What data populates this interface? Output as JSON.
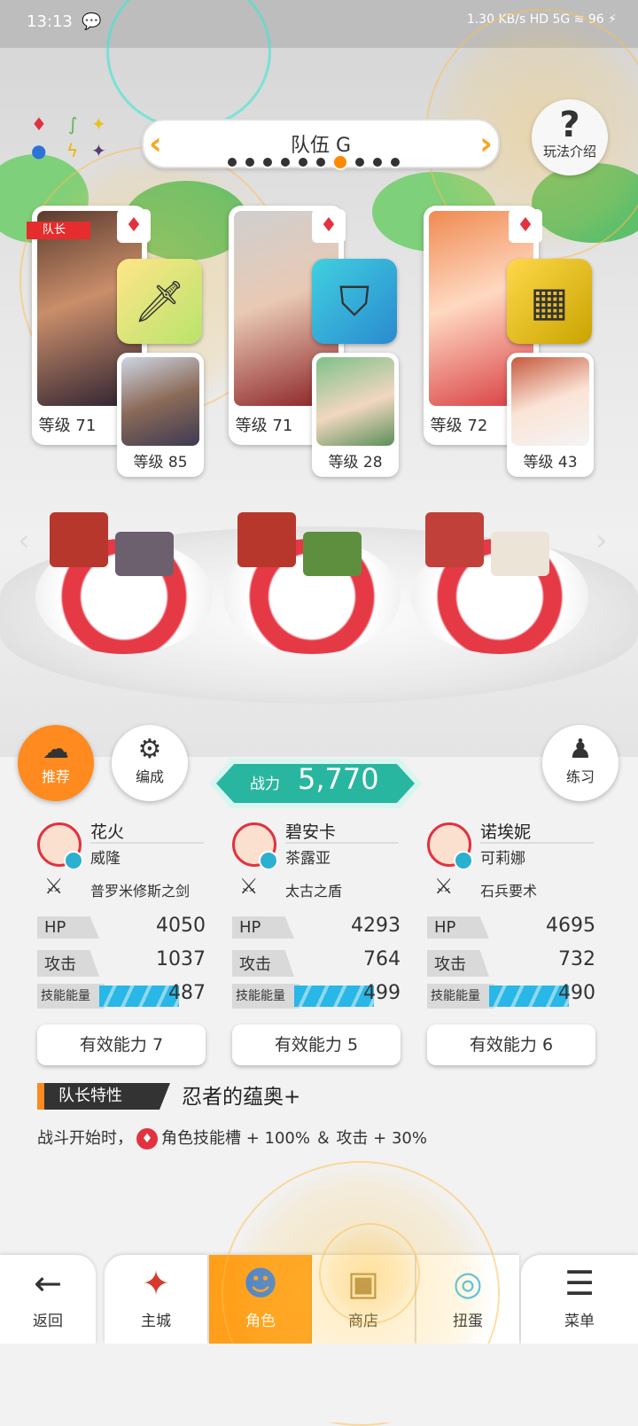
{
  "status_bar": {
    "time": "13:13",
    "network_speed": "1.30 KB/s",
    "hd": "HD",
    "signal": "5G",
    "battery": "96"
  },
  "team": {
    "title": "队伍 G",
    "page_count": 10,
    "active_index": 7,
    "prev_icon": "chevron-left-icon",
    "next_icon": "chevron-right-icon"
  },
  "help": {
    "label": "玩法介绍"
  },
  "leader_tag": "队长",
  "characters": [
    {
      "level": "等级 71",
      "partner_level": "等级 85",
      "equip_icon": "sword-icon"
    },
    {
      "level": "等级 71",
      "partner_level": "等级 28",
      "equip_icon": "shield-icon"
    },
    {
      "level": "等级 72",
      "partner_level": "等级 43",
      "equip_icon": "stone-tablet-icon"
    }
  ],
  "actions": {
    "recommend": "推荐",
    "formation": "编成",
    "practice": "练习"
  },
  "power": {
    "label": "战力",
    "value": "5,770"
  },
  "columns": [
    {
      "name": "花火",
      "partner": "威隆",
      "weapon": "普罗米修斯之剑",
      "hp_label": "HP",
      "hp": "4050",
      "atk_label": "攻击",
      "atk": "1037",
      "energy_label": "技能能量",
      "energy": "487",
      "ability": "有效能力 7"
    },
    {
      "name": "碧安卡",
      "partner": "茶露亚",
      "weapon": "太古之盾",
      "hp_label": "HP",
      "hp": "4293",
      "atk_label": "攻击",
      "atk": "764",
      "energy_label": "技能能量",
      "energy": "499",
      "ability": "有效能力 5"
    },
    {
      "name": "诺埃妮",
      "partner": "可莉娜",
      "weapon": "石兵要术",
      "hp_label": "HP",
      "hp": "4695",
      "atk_label": "攻击",
      "atk": "732",
      "energy_label": "技能能量",
      "energy": "490",
      "ability": "有效能力 6"
    }
  ],
  "leader_trait": {
    "tag": "队长特性",
    "name": "忍者的蕴奥+",
    "desc_prefix": "战斗开始时，",
    "desc_suffix": "角色技能槽 + 100% ＆ 攻击 + 30%"
  },
  "nav": [
    {
      "label": "返回",
      "icon": "back-arrow-icon"
    },
    {
      "label": "主城",
      "icon": "castle-icon"
    },
    {
      "label": "角色",
      "icon": "character-icon"
    },
    {
      "label": "商店",
      "icon": "shop-icon"
    },
    {
      "label": "扭蛋",
      "icon": "gacha-icon"
    },
    {
      "label": "菜单",
      "icon": "menu-icon"
    }
  ],
  "colors": {
    "accent": "#ff8a1f",
    "power": "#29b6a0",
    "element_red": "#e23240",
    "energy": "#28b7e6"
  }
}
